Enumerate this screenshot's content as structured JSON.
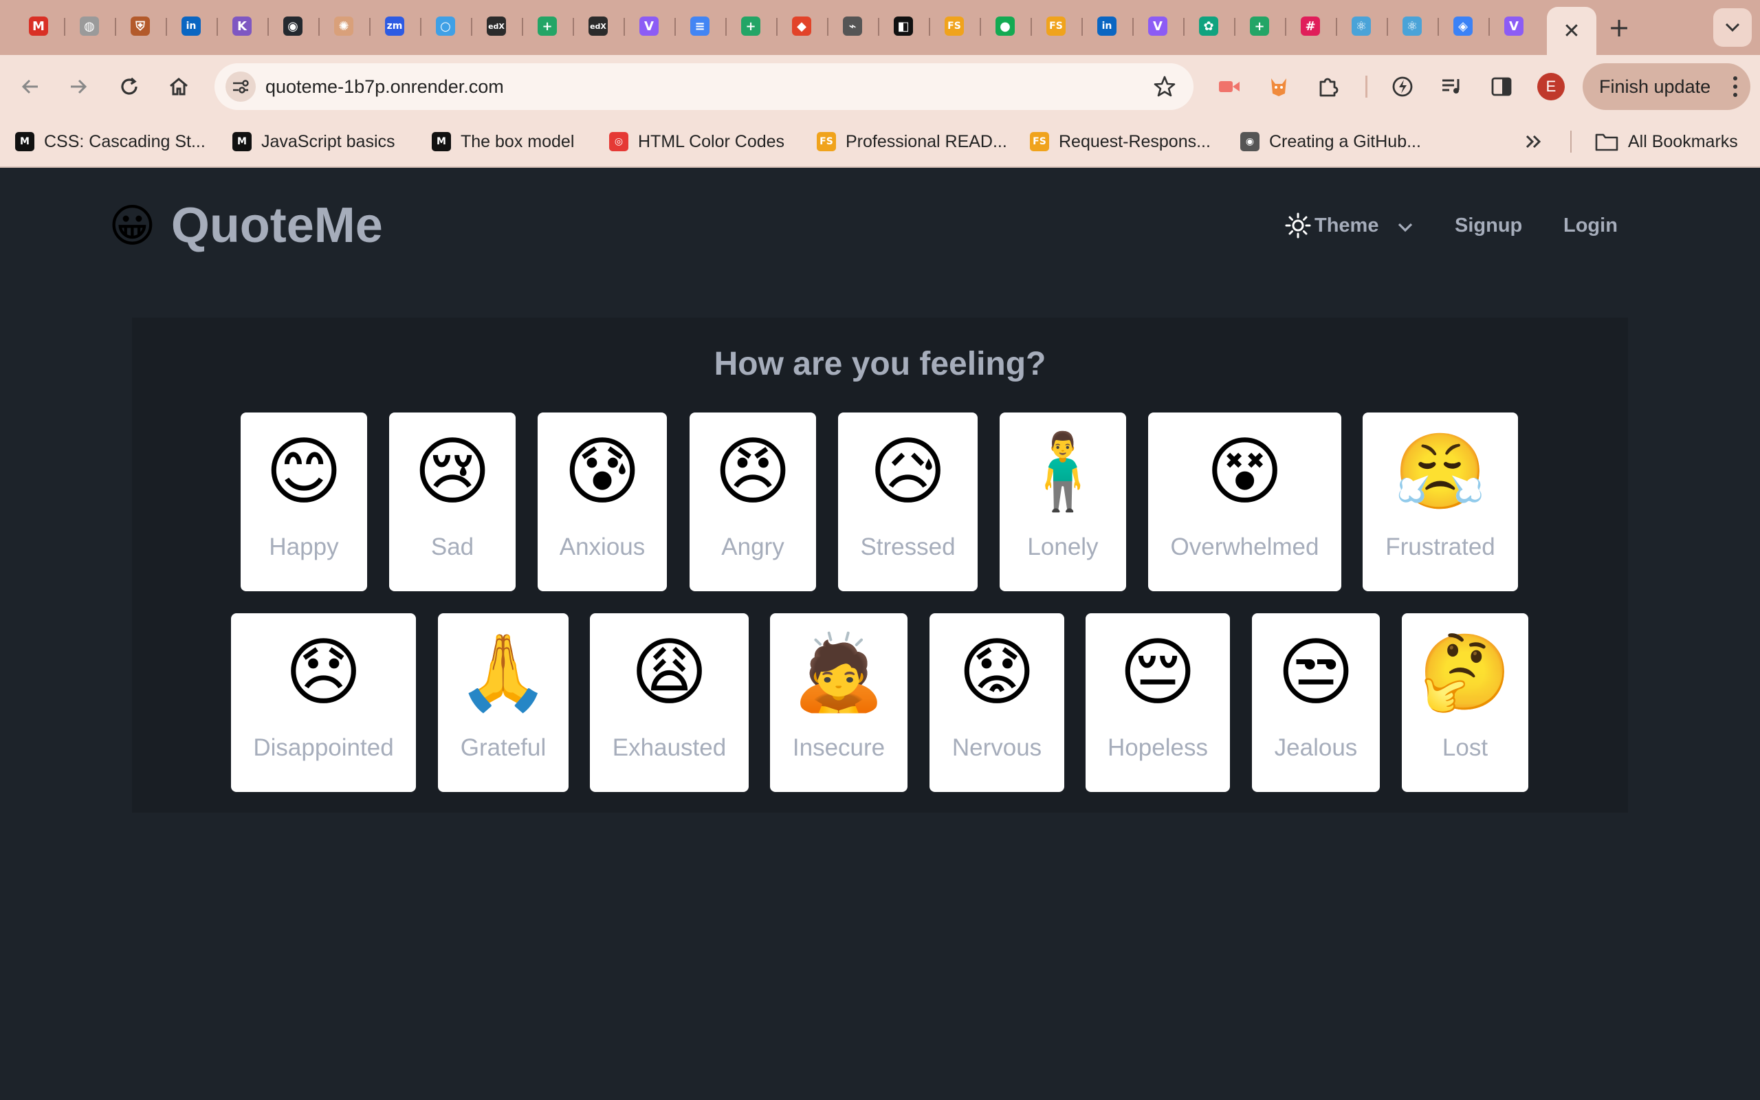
{
  "browser": {
    "tabs": [
      {
        "icon": "gmail-icon",
        "glyph": "M",
        "color": "#d93025"
      },
      {
        "icon": "globe-icon",
        "glyph": "◍",
        "color": "#9a9a9a"
      },
      {
        "icon": "shield-icon",
        "glyph": "⛨",
        "color": "#b35a2b"
      },
      {
        "icon": "linkedin-icon",
        "glyph": "in",
        "color": "#0a66c2"
      },
      {
        "icon": "hackmd-icon",
        "glyph": "K",
        "color": "#7e57c2"
      },
      {
        "icon": "github-icon",
        "glyph": "◉",
        "color": "#24292f"
      },
      {
        "icon": "sun-logo-icon",
        "glyph": "✺",
        "color": "#d9a07a"
      },
      {
        "icon": "zoom-icon",
        "glyph": "zm",
        "color": "#2d5be3"
      },
      {
        "icon": "circle-icon",
        "glyph": "○",
        "color": "#3fa0e6"
      },
      {
        "icon": "edx-icon",
        "glyph": "edX",
        "color": "#2b2b2b"
      },
      {
        "icon": "sheets-icon",
        "glyph": "+",
        "color": "#23a566"
      },
      {
        "icon": "edx-icon",
        "glyph": "edX",
        "color": "#2b2b2b"
      },
      {
        "icon": "vite-icon",
        "glyph": "V",
        "color": "#8c5cf5"
      },
      {
        "icon": "docs-icon",
        "glyph": "≡",
        "color": "#4285f4"
      },
      {
        "icon": "sheets-icon",
        "glyph": "+",
        "color": "#23a566"
      },
      {
        "icon": "gitlab-icon",
        "glyph": "◆",
        "color": "#e24329"
      },
      {
        "icon": "link-icon",
        "glyph": "⌁",
        "color": "#ffffff"
      },
      {
        "icon": "notion-icon",
        "glyph": "◧",
        "color": "#111111"
      },
      {
        "icon": "fs-icon",
        "glyph": "FS",
        "color": "#f0a31c"
      },
      {
        "icon": "mongodb-icon",
        "glyph": "●",
        "color": "#13aa52"
      },
      {
        "icon": "fs-icon",
        "glyph": "FS",
        "color": "#f0a31c"
      },
      {
        "icon": "linkedin-icon",
        "glyph": "in",
        "color": "#0a66c2"
      },
      {
        "icon": "vite-icon",
        "glyph": "V",
        "color": "#8c5cf5"
      },
      {
        "icon": "openai-icon",
        "glyph": "✿",
        "color": "#10a37f"
      },
      {
        "icon": "sheets-icon",
        "glyph": "+",
        "color": "#23a566"
      },
      {
        "icon": "slack-icon",
        "glyph": "#",
        "color": "#e01e5a"
      },
      {
        "icon": "react-icon",
        "glyph": "⚛",
        "color": "#4aa3d8"
      },
      {
        "icon": "react-icon",
        "glyph": "⚛",
        "color": "#4aa3d8"
      },
      {
        "icon": "cube-icon",
        "glyph": "◈",
        "color": "#3b82f6"
      },
      {
        "icon": "vite-icon",
        "glyph": "V",
        "color": "#8c5cf5"
      }
    ],
    "url": "quoteme-1b7p.onrender.com",
    "finish_update": "Finish update",
    "profile_initial": "E",
    "bookmarks": [
      {
        "label": "CSS: Cascading St...",
        "icon": "mdn-icon",
        "glyph": "M",
        "color": "#111111"
      },
      {
        "label": "JavaScript basics",
        "icon": "mdn-icon",
        "glyph": "M",
        "color": "#111111"
      },
      {
        "label": "The box model",
        "icon": "mdn-icon",
        "glyph": "M",
        "color": "#111111"
      },
      {
        "label": "HTML Color Codes",
        "icon": "color-wheel-icon",
        "glyph": "◎",
        "color": "#e53935"
      },
      {
        "label": "Professional READ...",
        "icon": "fs-icon",
        "glyph": "FS",
        "color": "#f0a31c"
      },
      {
        "label": "Request-Respons...",
        "icon": "fs-icon",
        "glyph": "FS",
        "color": "#f0a31c"
      },
      {
        "label": "Creating a GitHub...",
        "icon": "github-icon",
        "glyph": "◉",
        "color": "#555555"
      }
    ],
    "all_bookmarks": "All Bookmarks"
  },
  "page": {
    "brand": {
      "logo": "😀",
      "name": "QuoteMe"
    },
    "nav": {
      "theme": "Theme",
      "signup": "Signup",
      "login": "Login"
    },
    "heading": "How are you feeling?",
    "moods_row1": [
      {
        "emoji": "😊",
        "label": "Happy"
      },
      {
        "emoji": "😢",
        "label": "Sad"
      },
      {
        "emoji": "😰",
        "label": "Anxious"
      },
      {
        "emoji": "😠",
        "label": "Angry"
      },
      {
        "emoji": "😥",
        "label": "Stressed"
      },
      {
        "emoji": "🧍‍♂️",
        "label": "Lonely"
      },
      {
        "emoji": "😵",
        "label": "Overwhelmed"
      },
      {
        "emoji": "😤",
        "label": "Frustrated"
      }
    ],
    "moods_row2": [
      {
        "emoji": "😞",
        "label": "Disappointed"
      },
      {
        "emoji": "🙏",
        "label": "Grateful"
      },
      {
        "emoji": "😩",
        "label": "Exhausted"
      },
      {
        "emoji": "🙇",
        "label": "Insecure"
      },
      {
        "emoji": "😟",
        "label": "Nervous"
      },
      {
        "emoji": "😔",
        "label": "Hopeless"
      },
      {
        "emoji": "😒",
        "label": "Jealous"
      },
      {
        "emoji": "🤔",
        "label": "Lost"
      }
    ],
    "colors": {
      "page_bg": "#1d232a",
      "panel_bg": "#191e24",
      "text": "#a6adbb",
      "card_bg": "#ffffff"
    }
  }
}
